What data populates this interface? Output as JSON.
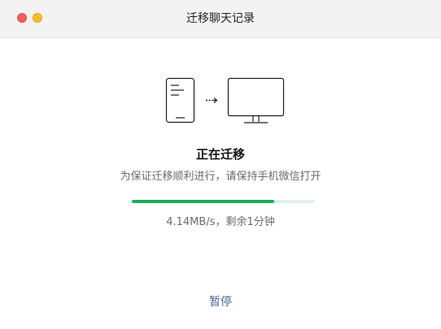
{
  "window": {
    "title": "迁移聊天记录"
  },
  "status": {
    "title": "正在迁移",
    "subtitle": "为保证迁移顺利进行，请保持手机微信打开"
  },
  "progress": {
    "fraction": 0.78,
    "speed_text": "4.14MB/s，剩余1分钟"
  },
  "actions": {
    "pause_label": "暂停"
  },
  "colors": {
    "progress_fill": "#1aad5a",
    "progress_track": "#dff0e7",
    "link": "#4a6796",
    "close_button": "#fe5f57",
    "minimize_button": "#febc2e"
  }
}
